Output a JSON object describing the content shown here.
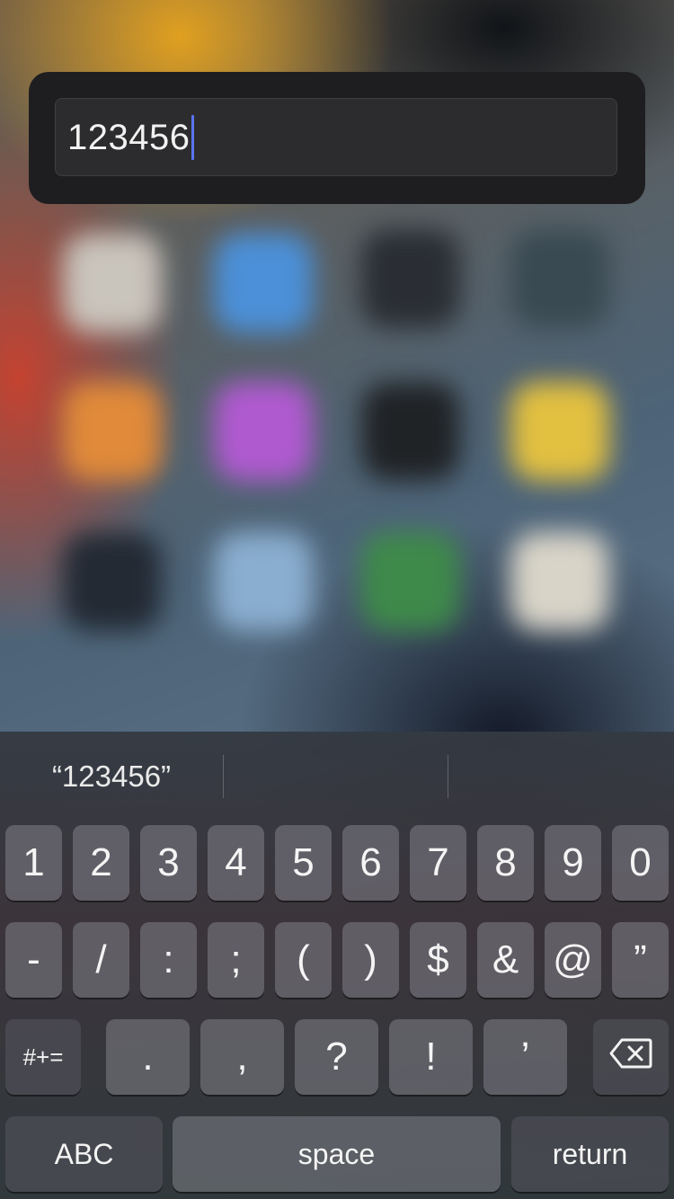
{
  "alert": {
    "text_field": {
      "value": "123456"
    }
  },
  "keyboard": {
    "suggestions": [
      "“123456”",
      "",
      ""
    ],
    "row1": [
      "1",
      "2",
      "3",
      "4",
      "5",
      "6",
      "7",
      "8",
      "9",
      "0"
    ],
    "row2": [
      "-",
      "/",
      ":",
      ";",
      "(",
      ")",
      "$",
      "&",
      "@",
      "”"
    ],
    "row3": {
      "shift_label": "#+=",
      "keys": [
        ".",
        ",",
        "?",
        "!",
        "’"
      ],
      "delete_icon": "delete-backspace-icon"
    },
    "row4": {
      "abc_label": "ABC",
      "space_label": "space",
      "return_label": "return"
    }
  },
  "colors": {
    "caret": "#5b73f0",
    "panel_bg": "#1e1e20",
    "field_bg": "#2c2c2e"
  }
}
